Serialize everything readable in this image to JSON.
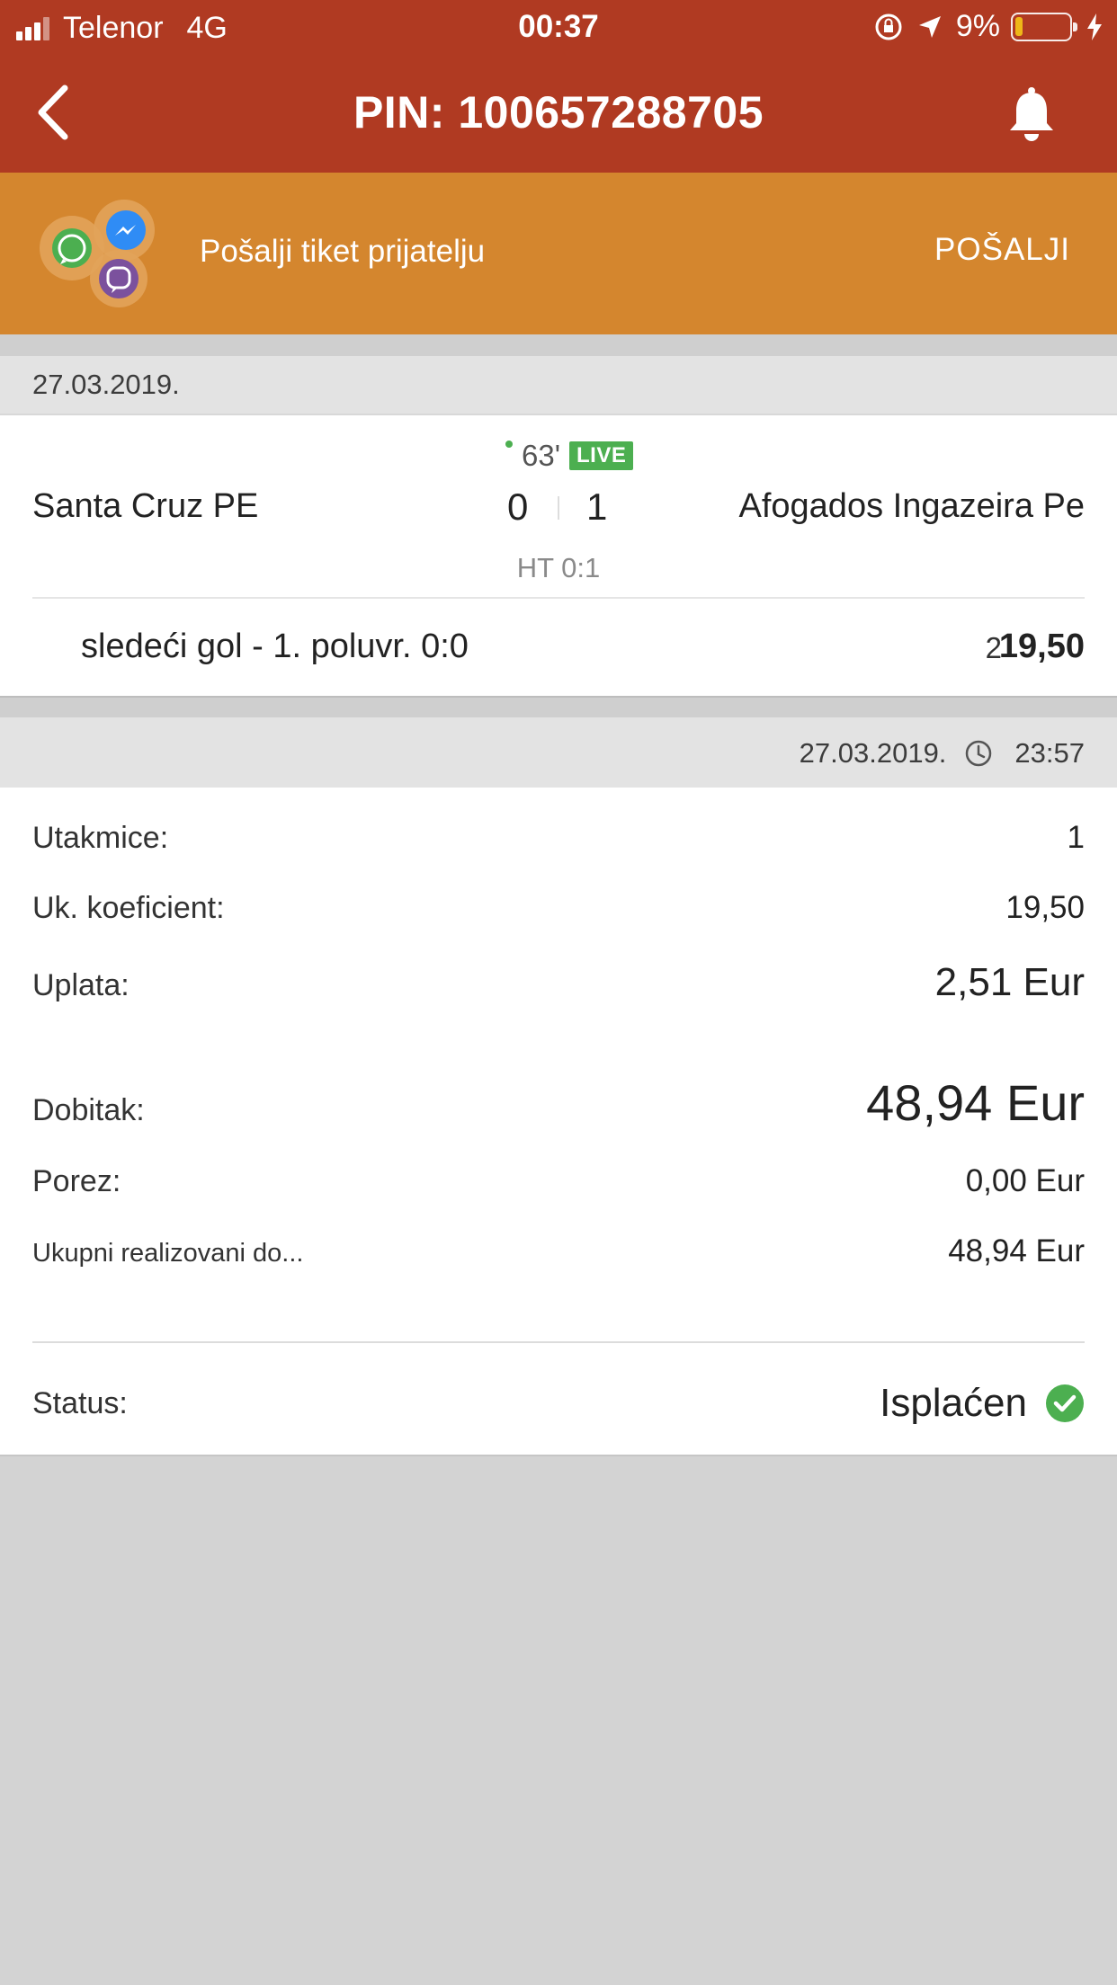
{
  "status_bar": {
    "carrier": "Telenor",
    "network": "4G",
    "time": "00:37",
    "battery": "9%"
  },
  "header": {
    "title": "PIN: 100657288705",
    "back_icon": "chevron-left-icon",
    "bell_icon": "bell-icon"
  },
  "share_banner": {
    "text": "Pošalji tiket prijatelju",
    "button_label": "POŠALJI",
    "icons": [
      "whatsapp-icon",
      "messenger-icon",
      "viber-icon"
    ]
  },
  "ticket": {
    "date": "27.03.2019.",
    "match": {
      "minute": "63'",
      "live_label": "LIVE",
      "home_team": "Santa Cruz PE",
      "away_team": "Afogados Ingazeira Pe",
      "home_score": "0",
      "away_score": "1",
      "ht_score": "HT 0:1",
      "bet_label": "sledeći gol - 1. poluvr. 0:0",
      "bet_pick": "2",
      "bet_odd": "19,50"
    },
    "placed_date": "27.03.2019.",
    "placed_time": "23:57"
  },
  "summary": {
    "matches_label": "Utakmice:",
    "matches_value": "1",
    "total_odds_label": "Uk. koeficient:",
    "total_odds_value": "19,50",
    "stake_label": "Uplata:",
    "stake_value": "2,51 Eur",
    "win_label": "Dobitak:",
    "win_value": "48,94 Eur",
    "tax_label": "Porez:",
    "tax_value": "0,00 Eur",
    "realized_label": "Ukupni realizovani do...",
    "realized_value": "48,94 Eur",
    "status_label": "Status:",
    "status_value": "Isplaćen"
  },
  "colors": {
    "header_red": "#b03a22",
    "banner_orange": "#d4862e",
    "live_green": "#4caf50",
    "background_gray": "#d3d3d3"
  }
}
